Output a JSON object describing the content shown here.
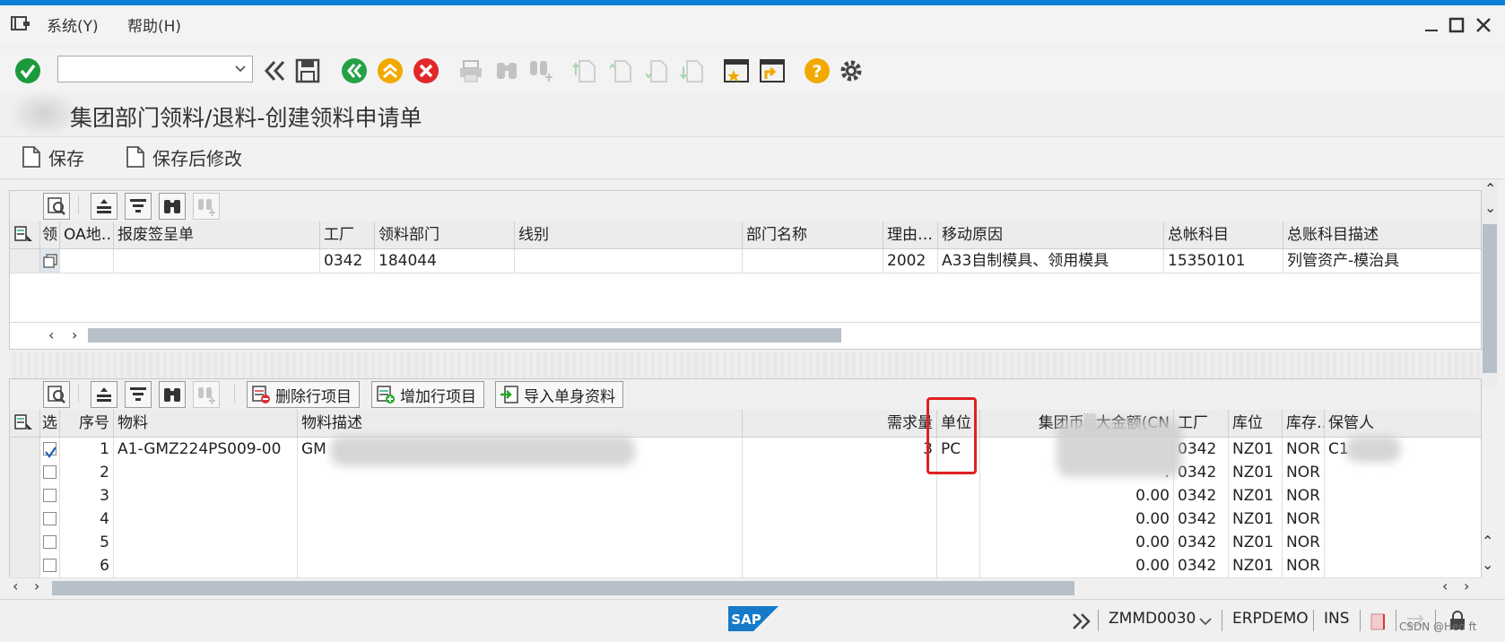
{
  "menu": {
    "system": "系统(Y)",
    "help": "帮助(H)"
  },
  "toolbar": {
    "command_field_value": ""
  },
  "page": {
    "title": "集团部门领料/退料-创建领料申请单"
  },
  "app_toolbar": {
    "save": "保存",
    "save_then_edit": "保存后修改"
  },
  "header_grid": {
    "columns": [
      "领",
      "OA地…",
      "报废签呈单",
      "工厂",
      "领料部门",
      "线别",
      "部门名称",
      "理由…",
      "移动原因",
      "总帐科目",
      "总账科目描述"
    ],
    "rows": [
      {
        "oa": "",
        "scrap": "",
        "plant": "0342",
        "dept": "184044",
        "line": "",
        "dept_name": "",
        "reason": "2002",
        "move_reason": "A33自制模具、领用模具",
        "gl": "15350101",
        "gl_desc": "列管资产-模治具"
      }
    ]
  },
  "item_grid": {
    "buttons": {
      "delete_row": "删除行项目",
      "add_row": "增加行项目",
      "import": "导入单身资料"
    },
    "columns": [
      "选",
      "序号",
      "物料",
      "物料描述",
      "需求量",
      "单位",
      "集团币",
      "工厂",
      "库位",
      "库存…",
      "保管人"
    ],
    "amount_header_suffix": "大金额(CN",
    "rows": [
      {
        "sel": true,
        "no": "1",
        "material": "A1-GMZ224PS009-00",
        "desc": "GM",
        "qty": "3",
        "unit": "PC",
        "amount": "",
        "plant": "0342",
        "sloc": "NZ01",
        "stock": "NOR",
        "keeper": "C1"
      },
      {
        "sel": false,
        "no": "2",
        "material": "",
        "desc": "",
        "qty": "",
        "unit": "",
        "amount": ".",
        "plant": "0342",
        "sloc": "NZ01",
        "stock": "NOR",
        "keeper": ""
      },
      {
        "sel": false,
        "no": "3",
        "material": "",
        "desc": "",
        "qty": "",
        "unit": "",
        "amount": "0.00",
        "plant": "0342",
        "sloc": "NZ01",
        "stock": "NOR",
        "keeper": ""
      },
      {
        "sel": false,
        "no": "4",
        "material": "",
        "desc": "",
        "qty": "",
        "unit": "",
        "amount": "0.00",
        "plant": "0342",
        "sloc": "NZ01",
        "stock": "NOR",
        "keeper": ""
      },
      {
        "sel": false,
        "no": "5",
        "material": "",
        "desc": "",
        "qty": "",
        "unit": "",
        "amount": "0.00",
        "plant": "0342",
        "sloc": "NZ01",
        "stock": "NOR",
        "keeper": ""
      },
      {
        "sel": false,
        "no": "6",
        "material": "",
        "desc": "",
        "qty": "",
        "unit": "",
        "amount": "0.00",
        "plant": "0342",
        "sloc": "NZ01",
        "stock": "NOR",
        "keeper": ""
      }
    ]
  },
  "statusbar": {
    "transaction": "ZMMD0030",
    "system": "ERPDEMO",
    "mode": "INS"
  },
  "watermark": "CSDN @Heo ft",
  "colors": {
    "accent": "#0a7fd6",
    "ok_green": "#1a9a3a",
    "nav_green": "#26a046",
    "nav_yellow": "#f1a900",
    "cancel_red": "#e02828",
    "highlight_red": "#e02020"
  }
}
